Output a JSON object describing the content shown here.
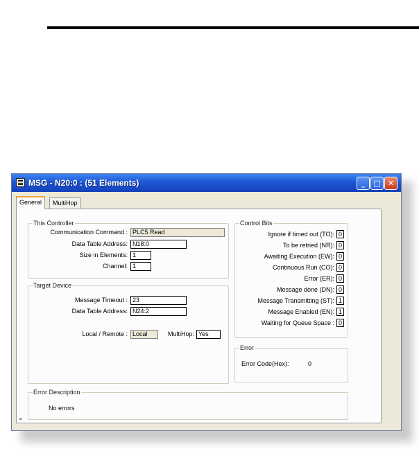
{
  "window": {
    "title": "MSG - N20:0 : (51 Elements)"
  },
  "tabs": [
    {
      "label": "General"
    },
    {
      "label": "MultiHop"
    }
  ],
  "this_controller": {
    "legend": "This Controller",
    "communication_command_label": "Communication Command :",
    "communication_command_value": "PLC5 Read",
    "data_table_address_label": "Data Table Address:",
    "data_table_address_value": "N18:0",
    "size_in_elements_label": "Size in Elements:",
    "size_in_elements_value": "1",
    "channel_label": "Channel:",
    "channel_value": "1"
  },
  "target_device": {
    "legend": "Target Device",
    "message_timeout_label": "Message Timeout :",
    "message_timeout_value": "23",
    "data_table_address_label": "Data Table Address:",
    "data_table_address_value": "N24:2",
    "local_remote_label": "Local / Remote :",
    "local_remote_value": "Local",
    "multihop_label": "MultiHop:",
    "multihop_value": "Yes"
  },
  "control_bits": {
    "legend": "Control Bits",
    "items": [
      {
        "label": "Ignore if timed out (TO):",
        "value": "0"
      },
      {
        "label": "To be retried (NR):",
        "value": "0"
      },
      {
        "label": "Awaiting Execution (EW):",
        "value": "0"
      },
      {
        "label": "Continuous Run (CO):",
        "value": "0"
      },
      {
        "label": "Error (ER):",
        "value": "0"
      },
      {
        "label": "Message done (DN):",
        "value": "0"
      },
      {
        "label": "Message Transmitting (ST):",
        "value": "1"
      },
      {
        "label": "Message Enabled (EN):",
        "value": "1"
      },
      {
        "label": "Waiting for Queue Space :",
        "value": "0"
      }
    ]
  },
  "error": {
    "legend": "Error",
    "code_label": "Error Code(Hex):",
    "code_value": "0"
  },
  "error_description": {
    "legend": "Error Description",
    "text": "No errors"
  },
  "colors": {
    "titlebar": "#1e56d6",
    "active_tab_accent": "#f5a53b",
    "dialog_bg": "#ece9d8"
  }
}
